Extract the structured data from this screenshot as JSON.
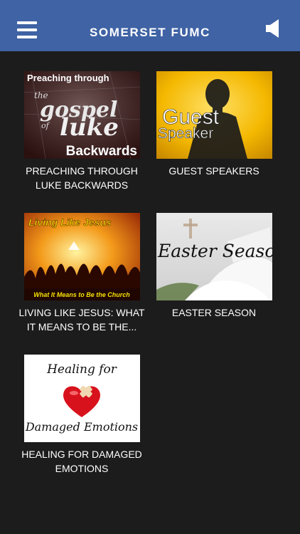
{
  "header": {
    "title": "SOMERSET FUMC",
    "menu_icon": "hamburger-menu-icon",
    "sound_icon": "speaker-icon"
  },
  "colors": {
    "header_bg": "#3f63a4",
    "page_bg": "#1c1c1c",
    "caption": "#ffffff"
  },
  "series": [
    {
      "caption": "PREACHING THROUGH LUKE BACKWARDS",
      "image_text_top": "Preaching through",
      "image_text_mid1": "the",
      "image_text_mid2": "gospel",
      "image_text_mid3": "of",
      "image_text_mid4": "luke",
      "image_text_bottom": "Backwards"
    },
    {
      "caption": "GUEST SPEAKERS",
      "image_text_1": "Guest",
      "image_text_2": "Speaker"
    },
    {
      "caption": "LIVING LIKE JESUS: WHAT IT MEANS TO BE THE...",
      "image_text_top": "Living Like Jesus",
      "image_text_bottom": "What It Means to Be the Church"
    },
    {
      "caption": "EASTER SEASON",
      "image_text": "Easter Season"
    },
    {
      "caption": "HEALING FOR DAMAGED EMOTIONS",
      "image_text_top": "Healing for",
      "image_text_bottom": "Damaged Emotions"
    }
  ]
}
